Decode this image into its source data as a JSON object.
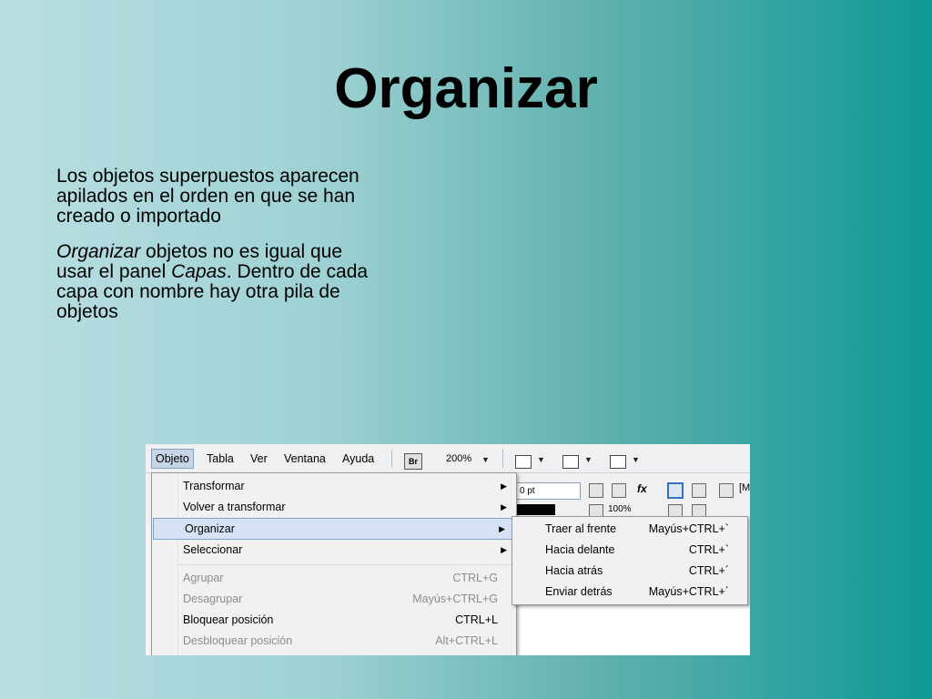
{
  "slide": {
    "title": "Organizar",
    "para1": "Los objetos superpuestos aparecen apilados en el orden en que se han creado o importado",
    "para2": {
      "em1": "Organizar",
      "t1": " objetos no es igual que usar el panel ",
      "em2": "Capas",
      "t2": ". Dentro de cada capa con nombre hay otra pila de objetos"
    }
  },
  "menubar": {
    "items": [
      "Objeto",
      "Tabla",
      "Ver",
      "Ventana",
      "Ayuda"
    ],
    "br_label": "Br",
    "zoom": "200%"
  },
  "toolbar": {
    "stroke_value": "0 pt",
    "opacity": "100%",
    "fx_label": "fx",
    "partial_text": "[M"
  },
  "menu": {
    "items": [
      {
        "label": "Transformar",
        "shortcut": "",
        "submenu": true,
        "disabled": false
      },
      {
        "label": "Volver a transformar",
        "shortcut": "",
        "submenu": true,
        "disabled": false
      },
      {
        "label": "Organizar",
        "shortcut": "",
        "submenu": true,
        "disabled": false
      },
      {
        "label": "Seleccionar",
        "shortcut": "",
        "submenu": true,
        "disabled": false
      },
      {
        "label": "Agrupar",
        "shortcut": "CTRL+G",
        "submenu": false,
        "disabled": true
      },
      {
        "label": "Desagrupar",
        "shortcut": "Mayús+CTRL+G",
        "submenu": false,
        "disabled": true
      },
      {
        "label": "Bloquear posición",
        "shortcut": "CTRL+L",
        "submenu": false,
        "disabled": false
      },
      {
        "label": "Desbloquear posición",
        "shortcut": "Alt+CTRL+L",
        "submenu": false,
        "disabled": true
      }
    ]
  },
  "submenu": {
    "items": [
      {
        "label": "Traer al frente",
        "shortcut": "Mayús+CTRL+`"
      },
      {
        "label": "Hacia delante",
        "shortcut": "CTRL+`"
      },
      {
        "label": "Hacia atrás",
        "shortcut": "CTRL+´"
      },
      {
        "label": "Enviar detrás",
        "shortcut": "Mayús+CTRL+´"
      }
    ]
  },
  "icons": {
    "submenu_arrow": "triangle-right-icon",
    "dropdown_caret": "chevron-down-icon"
  }
}
